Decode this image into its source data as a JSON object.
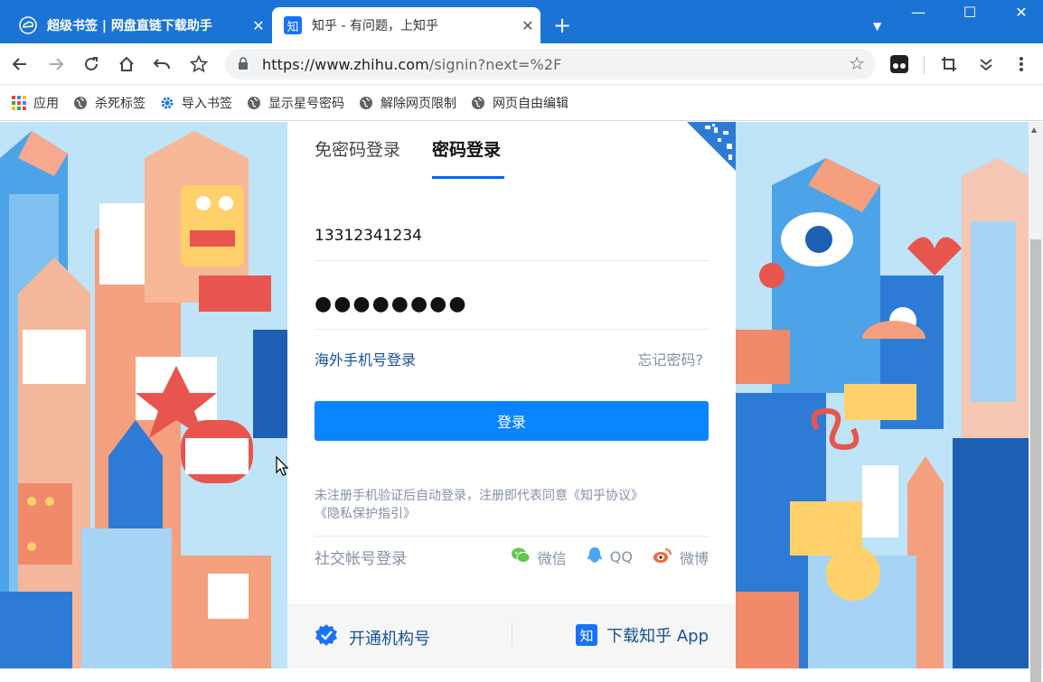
{
  "tabs": [
    {
      "title": "超级书签 | 网盘直链下载助手",
      "close": "✕",
      "active": false
    },
    {
      "title": "知乎 - 有问题，上知乎",
      "close": "✕",
      "active": true
    }
  ],
  "newtab": "+",
  "window": {
    "minimize": "—",
    "maximize": "☐",
    "close": "✕"
  },
  "address": {
    "scheme_host": "https://www.zhihu.com",
    "path": "/signin?next=%2F"
  },
  "bookmarks": [
    {
      "label": "应用",
      "icon": "apps-grid-icon"
    },
    {
      "label": "杀死标签",
      "icon": "globe-icon"
    },
    {
      "label": "导入书签",
      "icon": "gear-icon"
    },
    {
      "label": "显示星号密码",
      "icon": "globe-icon"
    },
    {
      "label": "解除网页限制",
      "icon": "globe-icon"
    },
    {
      "label": "网页自由编辑",
      "icon": "globe-icon"
    }
  ],
  "login": {
    "tab_sms": "免密码登录",
    "tab_password": "密码登录",
    "phone_value": "13312341234",
    "password_mask": "●●●●●●●●",
    "overseas": "海外手机号登录",
    "forgot": "忘记密码?",
    "submit": "登录",
    "terms_line1": "未注册手机验证后自动登录，注册即代表同意《知乎协议》",
    "terms_line2": "《隐私保护指引》",
    "social_label": "社交帐号登录",
    "wechat": "微信",
    "qq": "QQ",
    "weibo": "微博",
    "org": "开通机构号",
    "app_icon": "知",
    "app": "下载知乎 App"
  },
  "colors": {
    "accent": "#0a84ff",
    "chrome": "#1b73d6",
    "link": "#175199"
  }
}
